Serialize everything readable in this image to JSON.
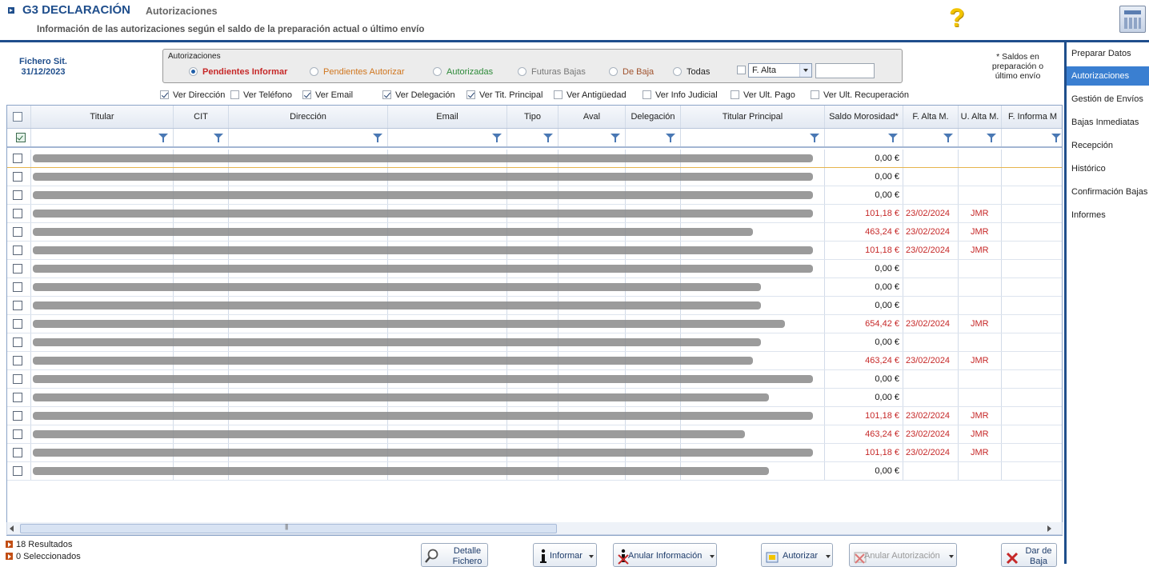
{
  "header": {
    "app_title": "G3 DECLARACIÓN",
    "section_title": "Autorizaciones",
    "subtitle": "Información de las autorizaciones según el saldo de la preparación actual o último envío"
  },
  "nav": {
    "items": [
      {
        "label": "Preparar Datos",
        "active": false
      },
      {
        "label": "Autorizaciones",
        "active": true
      },
      {
        "label": "Gestión de Envíos",
        "active": false
      },
      {
        "label": "Bajas Inmediatas",
        "active": false
      },
      {
        "label": "Recepción",
        "active": false
      },
      {
        "label": "Histórico",
        "active": false
      },
      {
        "label": "Confirmación Bajas",
        "active": false
      },
      {
        "label": "Informes",
        "active": false
      }
    ]
  },
  "filters": {
    "fichero_label": "Fichero Sit.",
    "fichero_date": "31/12/2023",
    "group_title": "Autorizaciones",
    "radios": [
      {
        "label": "Pendientes Informar",
        "checked": true,
        "color": "#c62828"
      },
      {
        "label": "Pendientes Autorizar",
        "checked": false,
        "color": "#d0761e"
      },
      {
        "label": "Autorizadas",
        "checked": false,
        "color": "#2e8b3a"
      },
      {
        "label": "Futuras Bajas",
        "checked": false,
        "color": "#777777"
      },
      {
        "label": "De Baja",
        "checked": false,
        "color": "#a0522d"
      },
      {
        "label": "Todas",
        "checked": false,
        "color": "#222222"
      }
    ],
    "date_filter_select": "F. Alta",
    "date_filter_value": "",
    "saldos_note": "* Saldos en preparación o último envío"
  },
  "show_options": [
    {
      "label": "Ver Dirección",
      "checked": true
    },
    {
      "label": "Ver Teléfono",
      "checked": false
    },
    {
      "label": "Ver Email",
      "checked": true
    },
    {
      "label": "Ver Delegación",
      "checked": true
    },
    {
      "label": "Ver Tit. Principal",
      "checked": true
    },
    {
      "label": "Ver Antigüedad",
      "checked": false
    },
    {
      "label": "Ver Info Judicial",
      "checked": false
    },
    {
      "label": "Ver Ult. Pago",
      "checked": false
    },
    {
      "label": "Ver Ult. Recuperación",
      "checked": false
    }
  ],
  "grid": {
    "columns": [
      "Titular",
      "CIT",
      "Dirección",
      "Email",
      "Tipo",
      "Aval",
      "Delegación",
      "Titular Principal",
      "Saldo Morosidad*",
      "F. Alta M.",
      "U. Alta M.",
      "F. Informa M"
    ],
    "rows": [
      {
        "saldo": "0,00 €",
        "f_alta": "",
        "u_alta": ""
      },
      {
        "saldo": "0,00 €",
        "f_alta": "",
        "u_alta": ""
      },
      {
        "saldo": "0,00 €",
        "f_alta": "",
        "u_alta": ""
      },
      {
        "saldo": "101,18 €",
        "f_alta": "23/02/2024",
        "u_alta": "JMR"
      },
      {
        "saldo": "463,24 €",
        "f_alta": "23/02/2024",
        "u_alta": "JMR"
      },
      {
        "saldo": "101,18 €",
        "f_alta": "23/02/2024",
        "u_alta": "JMR"
      },
      {
        "saldo": "0,00 €",
        "f_alta": "",
        "u_alta": ""
      },
      {
        "saldo": "0,00 €",
        "f_alta": "",
        "u_alta": ""
      },
      {
        "saldo": "0,00 €",
        "f_alta": "",
        "u_alta": ""
      },
      {
        "saldo": "654,42 €",
        "f_alta": "23/02/2024",
        "u_alta": "JMR"
      },
      {
        "saldo": "0,00 €",
        "f_alta": "",
        "u_alta": ""
      },
      {
        "saldo": "463,24 €",
        "f_alta": "23/02/2024",
        "u_alta": "JMR"
      },
      {
        "saldo": "0,00 €",
        "f_alta": "",
        "u_alta": ""
      },
      {
        "saldo": "0,00 €",
        "f_alta": "",
        "u_alta": ""
      },
      {
        "saldo": "101,18 €",
        "f_alta": "23/02/2024",
        "u_alta": "JMR"
      },
      {
        "saldo": "463,24 €",
        "f_alta": "23/02/2024",
        "u_alta": "JMR"
      },
      {
        "saldo": "101,18 €",
        "f_alta": "23/02/2024",
        "u_alta": "JMR"
      },
      {
        "saldo": "0,00 €",
        "f_alta": "",
        "u_alta": ""
      }
    ]
  },
  "footer": {
    "results": "18 Resultados",
    "selected": "0 Seleccionados"
  },
  "buttons": {
    "detalle": "Detalle Fichero",
    "informar": "Informar",
    "anular_info": "Anular Información",
    "autorizar": "Autorizar",
    "anular_autorizacion": "Anular Autorización",
    "dar_baja": "Dar de Baja"
  },
  "colors": {
    "brand": "#1f4e8c",
    "nav_active": "#3a7fd1",
    "alert_red": "#c62828"
  }
}
